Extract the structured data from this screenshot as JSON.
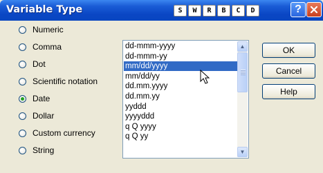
{
  "window": {
    "title": "Variable Type"
  },
  "titlebar_buttons": [
    "S",
    "W",
    "R",
    "B",
    "C",
    "D"
  ],
  "types": [
    {
      "label": "Numeric",
      "checked": false
    },
    {
      "label": "Comma",
      "checked": false
    },
    {
      "label": "Dot",
      "checked": false
    },
    {
      "label": "Scientific notation",
      "checked": false
    },
    {
      "label": "Date",
      "checked": true
    },
    {
      "label": "Dollar",
      "checked": false
    },
    {
      "label": "Custom currency",
      "checked": false
    },
    {
      "label": "String",
      "checked": false
    }
  ],
  "formats": {
    "items": [
      "dd-mmm-yyyy",
      "dd-mmm-yy",
      "mm/dd/yyyy",
      "mm/dd/yy",
      "dd.mm.yyyy",
      "dd.mm.yy",
      "yyddd",
      "yyyyddd",
      "q Q yyyy",
      "q Q yy"
    ],
    "selected": "mm/dd/yyyy"
  },
  "buttons": {
    "ok": "OK",
    "cancel": "Cancel",
    "help": "Help"
  },
  "colors": {
    "selection": "#316ac5",
    "titlebar": "#0a46c4"
  }
}
